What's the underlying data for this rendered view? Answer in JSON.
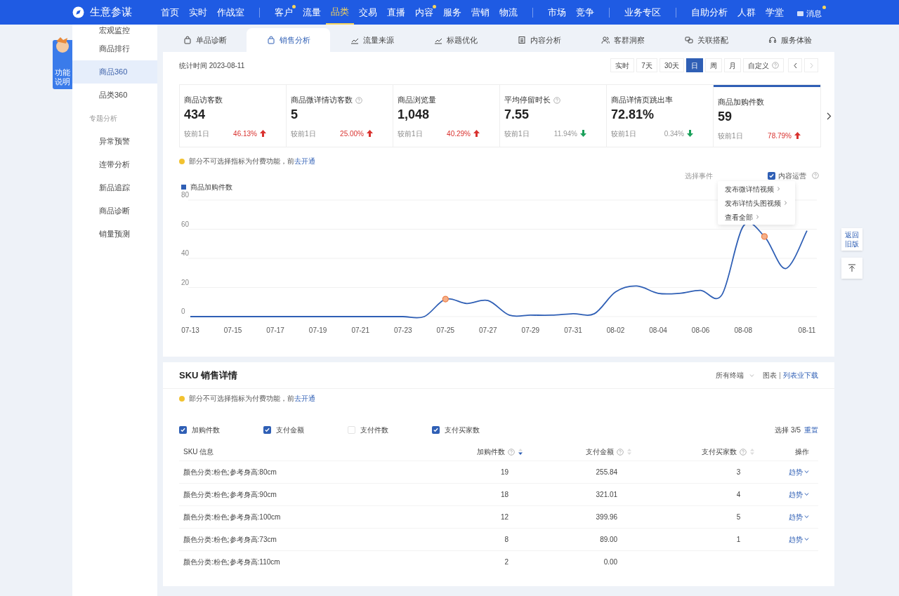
{
  "brand": {
    "name": "生意参谋"
  },
  "nav_groups": [
    [
      {
        "label": "首页",
        "selected": false,
        "dot": false
      },
      {
        "label": "实时",
        "selected": false,
        "dot": false
      },
      {
        "label": "作战室",
        "selected": false,
        "dot": false
      }
    ],
    [
      {
        "label": "客户",
        "selected": false,
        "dot": true
      },
      {
        "label": "流量",
        "selected": false,
        "dot": false
      },
      {
        "label": "品类",
        "selected": true,
        "dot": false
      },
      {
        "label": "交易",
        "selected": false,
        "dot": false
      },
      {
        "label": "直播",
        "selected": false,
        "dot": false
      },
      {
        "label": "内容",
        "selected": false,
        "dot": true
      },
      {
        "label": "服务",
        "selected": false,
        "dot": false
      },
      {
        "label": "营销",
        "selected": false,
        "dot": false
      },
      {
        "label": "物流",
        "selected": false,
        "dot": false
      }
    ],
    [
      {
        "label": "市场",
        "selected": false,
        "dot": false
      },
      {
        "label": "竞争",
        "selected": false,
        "dot": false
      }
    ],
    [
      {
        "label": "业务专区",
        "selected": false,
        "dot": false
      }
    ],
    [
      {
        "label": "自助分析",
        "selected": false,
        "dot": false
      },
      {
        "label": "人群",
        "selected": false,
        "dot": false
      },
      {
        "label": "学堂",
        "selected": false,
        "dot": false
      }
    ]
  ],
  "messages": {
    "label": "消息",
    "dot": true
  },
  "help_tab": {
    "label": "功能说明"
  },
  "sidebar": {
    "items": [
      {
        "kind": "item",
        "label": "宏观监控",
        "selected": false
      },
      {
        "kind": "item",
        "label": "商品排行",
        "selected": false
      },
      {
        "kind": "item",
        "label": "商品360",
        "selected": true
      },
      {
        "kind": "item",
        "label": "品类360",
        "selected": false
      },
      {
        "kind": "section",
        "label": "专题分析"
      },
      {
        "kind": "item",
        "label": "异常预警",
        "selected": false
      },
      {
        "kind": "item",
        "label": "连带分析",
        "selected": false
      },
      {
        "kind": "item",
        "label": "新品追踪",
        "selected": false
      },
      {
        "kind": "item",
        "label": "商品诊断",
        "selected": false
      },
      {
        "kind": "item",
        "label": "销量预测",
        "selected": false
      }
    ]
  },
  "tabs": [
    {
      "label": "单品诊断",
      "selected": false
    },
    {
      "label": "销售分析",
      "selected": true
    },
    {
      "label": "流量来源",
      "selected": false
    },
    {
      "label": "标题优化",
      "selected": false
    },
    {
      "label": "内容分析",
      "selected": false
    },
    {
      "label": "客群洞察",
      "selected": false
    },
    {
      "label": "关联搭配",
      "selected": false
    },
    {
      "label": "服务体验",
      "selected": false
    }
  ],
  "stat_time": "统计时间 2023-08-11",
  "ranges": [
    {
      "label": "实时",
      "selected": false,
      "help": false
    },
    {
      "label": "7天",
      "selected": false,
      "help": false
    },
    {
      "label": "30天",
      "selected": false,
      "help": false
    },
    {
      "label": "日",
      "selected": true,
      "help": false
    },
    {
      "label": "周",
      "selected": false,
      "help": false
    },
    {
      "label": "月",
      "selected": false,
      "help": false
    },
    {
      "label": "自定义",
      "selected": false,
      "help": true
    }
  ],
  "metrics": [
    {
      "title": "商品访客数",
      "help": false,
      "value": "434",
      "compare": "较前1日",
      "change": "46.13%",
      "rising": true,
      "selected": false
    },
    {
      "title": "商品微详情访客数",
      "help": true,
      "value": "5",
      "compare": "较前1日",
      "change": "25.00%",
      "rising": true,
      "selected": false
    },
    {
      "title": "商品浏览量",
      "help": false,
      "value": "1,048",
      "compare": "较前1日",
      "change": "40.29%",
      "rising": true,
      "selected": false
    },
    {
      "title": "平均停留时长",
      "help": true,
      "value": "7.55",
      "compare": "较前1日",
      "change": "11.94%",
      "rising": false,
      "selected": false
    },
    {
      "title": "商品详情页跳出率",
      "help": false,
      "value": "72.81%",
      "compare": "较前1日",
      "change": "0.34%",
      "rising": false,
      "selected": false
    },
    {
      "title": "商品加购件数",
      "help": false,
      "value": "59",
      "compare": "较前1日",
      "change": "78.79%",
      "rising": true,
      "selected": true
    }
  ],
  "notice": {
    "text": "部分不可选择指标为付费功能，前",
    "link": "去开通"
  },
  "events": {
    "label": "选择事件",
    "items": [
      {
        "label": "内容运营",
        "checked": true
      }
    ],
    "menu": [
      "发布微详情视频",
      "发布详情头图视频",
      "查看全部"
    ]
  },
  "chart_data": {
    "type": "line",
    "categories": [
      "07-13",
      null,
      "07-15",
      null,
      "07-17",
      null,
      "07-19",
      null,
      "07-21",
      null,
      "07-23",
      null,
      "07-25",
      null,
      "07-27",
      null,
      "07-29",
      null,
      "07-31",
      null,
      "08-02",
      null,
      "08-04",
      null,
      "08-06",
      null,
      "08-08",
      null,
      null,
      "08-11"
    ],
    "series": [
      {
        "name": "商品加购件数",
        "color": "#2f5fb5",
        "values": [
          0,
          0,
          0,
          0,
          0,
          0,
          0,
          0,
          0,
          0,
          0,
          0,
          12,
          9,
          11,
          1,
          1,
          1,
          2,
          2,
          17,
          21,
          16,
          16,
          18,
          15,
          62,
          55,
          33,
          59
        ]
      }
    ],
    "ylim": [
      0,
      80
    ],
    "yticks": [
      0,
      20,
      40,
      60,
      80
    ],
    "grid": true
  },
  "side_buttons": {
    "old_version": "返回旧版"
  },
  "sku": {
    "title": "SKU 销售详情",
    "terminal": "所有终端",
    "chart_label": "图表",
    "download": "列表业下载",
    "notice": {
      "text": "部分不可选择指标为付费功能，前",
      "link": "去开通"
    },
    "options": [
      {
        "label": "加购件数",
        "checked": true
      },
      {
        "label": "支付金额",
        "checked": true
      },
      {
        "label": "支付件数",
        "checked": false
      },
      {
        "label": "支付买家数",
        "checked": true
      }
    ],
    "selection": "选择 3/5",
    "reset": "重置",
    "columns": [
      {
        "label": "SKU 信息",
        "help": false,
        "sortable": false
      },
      {
        "label": "加购件数",
        "help": true,
        "sortable": true,
        "sorted": true
      },
      {
        "label": "支付金额",
        "help": true,
        "sortable": true,
        "sorted": false
      },
      {
        "label": "支付买家数",
        "help": true,
        "sortable": true,
        "sorted": false
      },
      {
        "label": "操作",
        "help": false,
        "sortable": false
      }
    ],
    "rows": [
      {
        "sku": "颜色分类:粉色;参考身高:80cm",
        "cart": "19",
        "amount": "255.84",
        "buyers": "3",
        "action": "趋势"
      },
      {
        "sku": "颜色分类:粉色;参考身高:90cm",
        "cart": "18",
        "amount": "321.01",
        "buyers": "4",
        "action": "趋势"
      },
      {
        "sku": "颜色分类:粉色;参考身高:100cm",
        "cart": "12",
        "amount": "399.96",
        "buyers": "5",
        "action": "趋势"
      },
      {
        "sku": "颜色分类:粉色;参考身高:73cm",
        "cart": "8",
        "amount": "89.00",
        "buyers": "1",
        "action": "趋势"
      },
      {
        "sku": "颜色分类:粉色;参考身高:110cm",
        "cart": "2",
        "amount": "0.00"
      }
    ]
  }
}
